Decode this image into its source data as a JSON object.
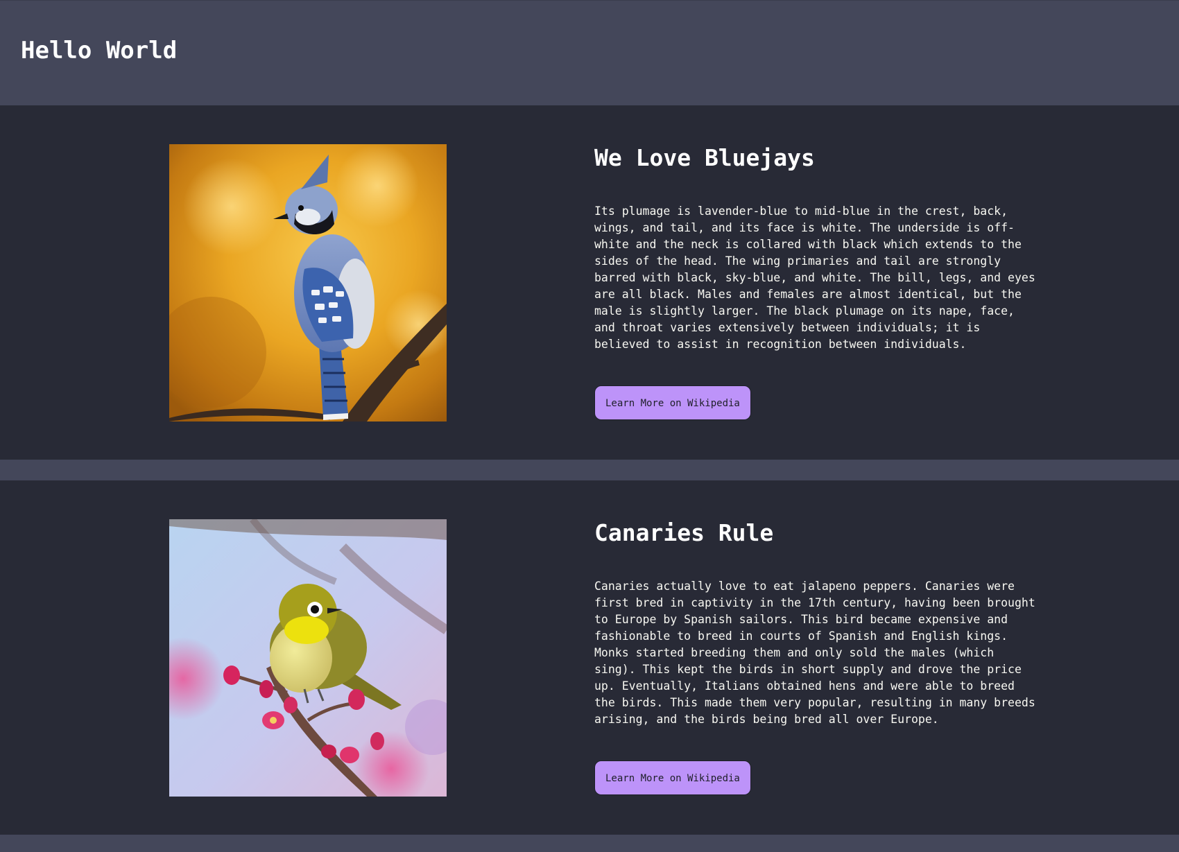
{
  "header": {
    "title": "Hello World"
  },
  "cards": [
    {
      "title": "We Love Bluejays",
      "text": "Its plumage is lavender-blue to mid-blue in the crest, back, wings, and tail, and its face is white. The underside is off-white and the neck is collared with black which extends to the sides of the head. The wing primaries and tail are strongly barred with black, sky-blue, and white. The bill, legs, and eyes are all black. Males and females are almost identical, but the male is slightly larger. The black plumage on its nape, face, and throat varies extensively between individuals; it is believed to assist in recognition between individuals.",
      "button_label": "Learn More on Wikipedia",
      "image": "bluejay-photo"
    },
    {
      "title": "Canaries Rule",
      "text": "Canaries actually love to eat jalapeno peppers. Canaries were first bred in captivity in the 17th century, having been brought to Europe by Spanish sailors. This bird became expensive and fashionable to breed in courts of Spanish and English kings. Monks started breeding them and only sold the males (which sing). This kept the birds in short supply and drove the price up. Eventually, Italians obtained hens and were able to breed the birds. This made them very popular, resulting in many breeds arising, and the birds being bred all over Europe.",
      "button_label": "Learn More on Wikipedia",
      "image": "canary-photo"
    }
  ],
  "colors": {
    "header_bg": "#44475a",
    "card_bg": "#282a36",
    "button_bg": "#bd93f9",
    "text": "#f8f8f2"
  }
}
